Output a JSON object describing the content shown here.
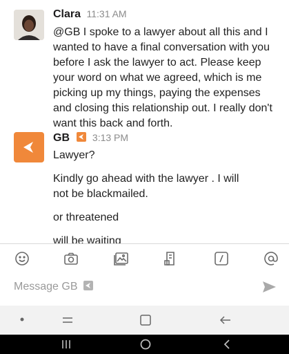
{
  "messages": [
    {
      "sender": "Clara",
      "time": "11:31 AM",
      "lines": [
        "@GB I spoke to a lawyer about all this and I",
        "wanted to have a final conversation with you",
        "before I ask the lawyer to act. Please keep",
        "your word on what we agreed, which is me",
        "picking up my things, paying the expenses",
        "and closing this relationship out. I really don't",
        "want this back and forth."
      ]
    },
    {
      "sender": "GB",
      "time": "3:13 PM",
      "paragraphs": [
        [
          "Lawyer?"
        ],
        [
          "Kindly go ahead with the lawyer . I will",
          "not be blackmailed."
        ],
        [
          "or threatened"
        ],
        [
          "will be waiting"
        ]
      ]
    }
  ],
  "composer": {
    "placeholder": "Message GB",
    "icons": [
      "emoji-icon",
      "camera-icon",
      "image-icon",
      "file-icon",
      "slash-command-icon",
      "mention-icon",
      "send-icon"
    ]
  },
  "colors": {
    "accent": "#f0883a",
    "text": "#1d1c1d",
    "muted": "#8b8b8b"
  }
}
